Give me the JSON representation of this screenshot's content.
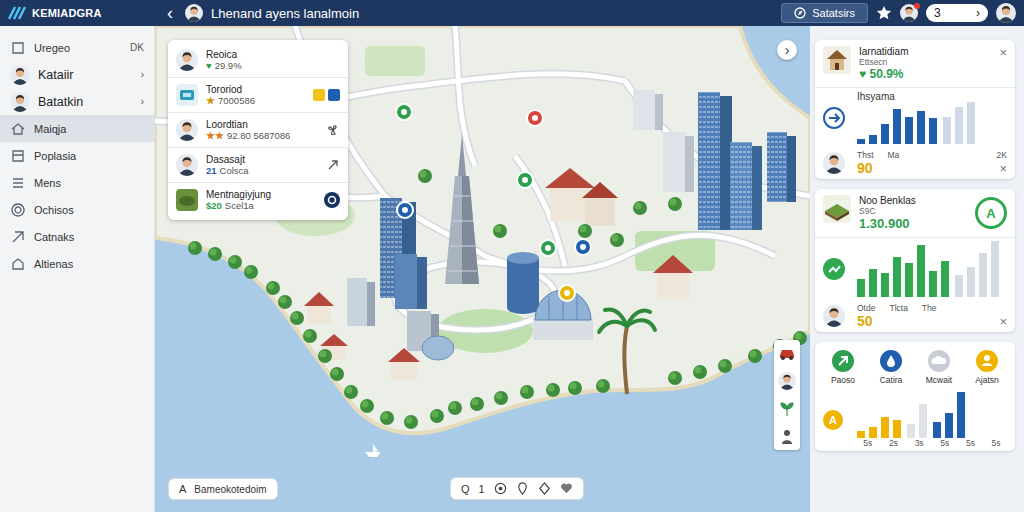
{
  "header": {
    "logo": "KEMIADGRA",
    "back": "‹",
    "title": "Lhenand ayens lanalmoin",
    "stats_button": "Satatsirs",
    "counter": "3",
    "counter_arrow": "›"
  },
  "sidebar": {
    "items": [
      {
        "label": "Uregeo",
        "trailing": "DK",
        "kind": "icon",
        "selected": false
      },
      {
        "label": "Kataiir",
        "trailing": "›",
        "kind": "avatar",
        "selected": false
      },
      {
        "label": "Batatkin",
        "trailing": "›",
        "kind": "avatar",
        "selected": false
      },
      {
        "label": "Maiqja",
        "trailing": "",
        "kind": "icon",
        "selected": true
      },
      {
        "label": "Poplasia",
        "trailing": "",
        "kind": "icon",
        "selected": false
      },
      {
        "label": "Mens",
        "trailing": "",
        "kind": "icon",
        "selected": false
      },
      {
        "label": "Ochisos",
        "trailing": "",
        "kind": "icon",
        "selected": false
      },
      {
        "label": "Catnaks",
        "trailing": "",
        "kind": "icon",
        "selected": false
      },
      {
        "label": "Altienas",
        "trailing": "",
        "kind": "icon",
        "selected": false
      }
    ]
  },
  "list_card": {
    "items": [
      {
        "title": "Reoica",
        "marker": "♥",
        "detail": "29.9%",
        "color": "#2e9e4f",
        "thumb": "avatar",
        "action": "none"
      },
      {
        "title": "Tororiod",
        "marker": "★",
        "detail": "7000586",
        "color": "#c99a06",
        "thumb": "icon",
        "action": "badges"
      },
      {
        "title": "Loordtian",
        "marker": "★★",
        "detail": "92.80 5687086",
        "color": "#e07b1a",
        "thumb": "avatar",
        "action": "fan"
      },
      {
        "title": "Dasasajt",
        "marker": "21",
        "detail": "Colsca",
        "color": "#1f5fae",
        "thumb": "avatar",
        "action": "arrow"
      },
      {
        "title": "Mentnagiyjung",
        "marker": "$20",
        "detail": "Scel1a",
        "color": "#2e9e4f",
        "thumb": "photo",
        "action": "dot"
      }
    ]
  },
  "expand": "›",
  "search_pill": {
    "icon": "A",
    "text": "Bameokotedoim"
  },
  "map_toolbar": {
    "label": "Q",
    "count": "1",
    "tools": [
      {
        "kind": "target"
      },
      {
        "kind": "pin"
      },
      {
        "kind": "drop"
      },
      {
        "kind": "heart"
      }
    ]
  },
  "side_tools": [
    {
      "kind": "car"
    },
    {
      "kind": "avatar"
    },
    {
      "kind": "plant"
    },
    {
      "kind": "person"
    }
  ],
  "map_pins": [
    {
      "color": "#1f5fae"
    },
    {
      "color": "#1f5fae"
    },
    {
      "color": "#2e9e4f"
    },
    {
      "color": "#d9453b"
    },
    {
      "color": "#2e9e4f"
    },
    {
      "color": "#2e9e4f"
    },
    {
      "color": "#e6b800"
    }
  ],
  "stats_card": {
    "title": "Iarnatidiam",
    "subtitle": "Ettsecn",
    "stat_icon": "♥",
    "stat": "50.9%",
    "close": "×",
    "chart_title": "Ihsyama",
    "chart": {
      "series": [
        {
          "color": "#1f5fae",
          "values": [
            6,
            10,
            22,
            38,
            30,
            36,
            28
          ]
        },
        {
          "color": "#cfd9e8",
          "values": [
            30,
            40,
            46
          ]
        }
      ]
    },
    "labels": [
      "Thst",
      "Ma",
      "2K"
    ],
    "value": "90",
    "footer_close": "×"
  },
  "benefits_card": {
    "title": "Noo Benklas",
    "subtitle": "S9C",
    "value_main": "1.30.900",
    "badge": "A",
    "chart": {
      "series": [
        {
          "color": "#2fa84f",
          "values": [
            18,
            28,
            24,
            40,
            34,
            52,
            26,
            36
          ]
        },
        {
          "color": "#d5dbe3",
          "values": [
            22,
            30,
            44,
            56
          ]
        }
      ]
    },
    "labels": [
      "Otde",
      "Tlcta",
      "The"
    ],
    "value": "50",
    "footer_close": "×"
  },
  "summary_card": {
    "tiles": [
      {
        "label": "Paoso",
        "color": "#2e9e4f",
        "kind": "arrow"
      },
      {
        "label": "Catira",
        "color": "#1f5fae",
        "kind": "drop"
      },
      {
        "label": "Mcwait",
        "color": "#c9ced6",
        "kind": "cloud"
      },
      {
        "label": "Ajatsn",
        "color": "#f0b400",
        "kind": "person"
      }
    ],
    "marker": "A",
    "chart": {
      "series": [
        {
          "color": "#f0b400",
          "values": [
            6,
            10,
            18,
            16
          ]
        },
        {
          "color": "#dfe3e8",
          "values": [
            12,
            30
          ]
        },
        {
          "color": "#1f5fae",
          "values": [
            14,
            22,
            40
          ]
        }
      ]
    },
    "labels": [
      "5s",
      "2s",
      "3s",
      "5s",
      "5s",
      "5s"
    ]
  }
}
